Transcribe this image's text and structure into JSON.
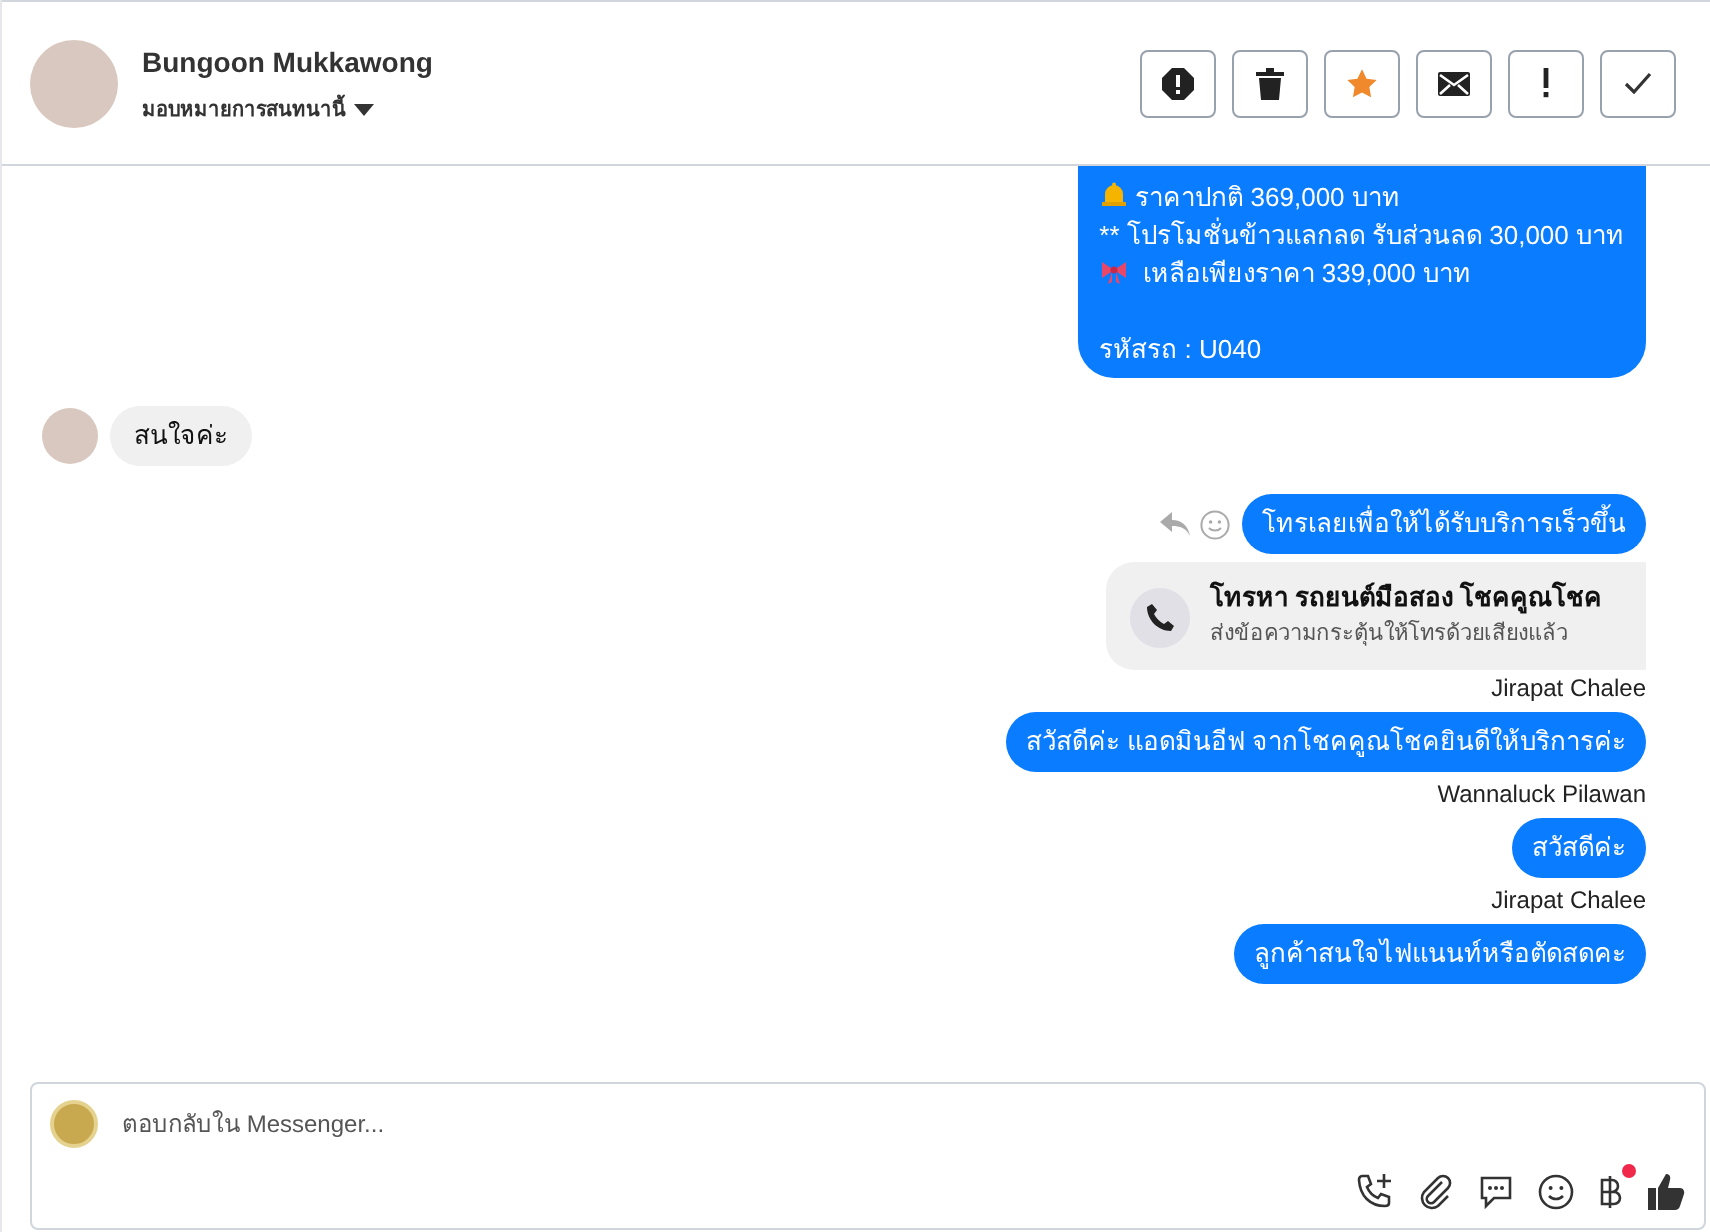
{
  "header": {
    "name": "Bungoon Mukkawong",
    "assign_label": "มอบหมายการสนทนานี้",
    "actions": [
      {
        "kind": "report"
      },
      {
        "kind": "delete"
      },
      {
        "kind": "star"
      },
      {
        "kind": "mail"
      },
      {
        "kind": "important"
      },
      {
        "kind": "done"
      }
    ]
  },
  "messages": [
    {
      "kind": "info_bubble",
      "lines": [
        {
          "kind": "bell",
          "text": "ราคาปกติ 369,000 บาท"
        },
        {
          "kind": "plain",
          "text": "** โปรโมชั่นข้าวแลกลด รับส่วนลด 30,000 บาท"
        },
        {
          "kind": "ribbon",
          "text": " เหลือเพียงราคา 339,000 บาท"
        },
        {
          "kind": "spaced",
          "text": "รหัสรถ : U040"
        }
      ]
    },
    {
      "kind": "incoming",
      "text": "สนใจค่ะ"
    },
    {
      "kind": "outgoing",
      "text": "โทรเลยเพื่อให้ได้รับบริการเร็วขึ้น",
      "hover_actions": true
    },
    {
      "kind": "call_card",
      "title": "โทรหา รถยนต์มือสอง โชคคูณโชค",
      "subtitle": "ส่งข้อความกระตุ้นให้โทรด้วยเสียงแล้ว"
    },
    {
      "kind": "sender",
      "text": "Jirapat Chalee"
    },
    {
      "kind": "outgoing",
      "text": "สวัสดีค่ะ แอดมินอีฟ จากโชคคูณโชคยินดีให้บริการค่ะ",
      "hover_actions": false
    },
    {
      "kind": "sender",
      "text": "Wannaluck Pilawan"
    },
    {
      "kind": "outgoing",
      "text": "สวัสดีค่ะ",
      "hover_actions": false
    },
    {
      "kind": "sender",
      "text": "Jirapat Chalee"
    },
    {
      "kind": "outgoing",
      "text": "ลูกค้าสนใจไฟแนนท์หรือตัดสดคะ",
      "hover_actions": false
    }
  ],
  "composer": {
    "placeholder": "ตอบกลับใน Messenger...",
    "tools": [
      {
        "kind": "call"
      },
      {
        "kind": "attach"
      },
      {
        "kind": "saved_reply"
      },
      {
        "kind": "emoji"
      },
      {
        "kind": "payment",
        "badge": true
      },
      {
        "kind": "like"
      }
    ]
  }
}
